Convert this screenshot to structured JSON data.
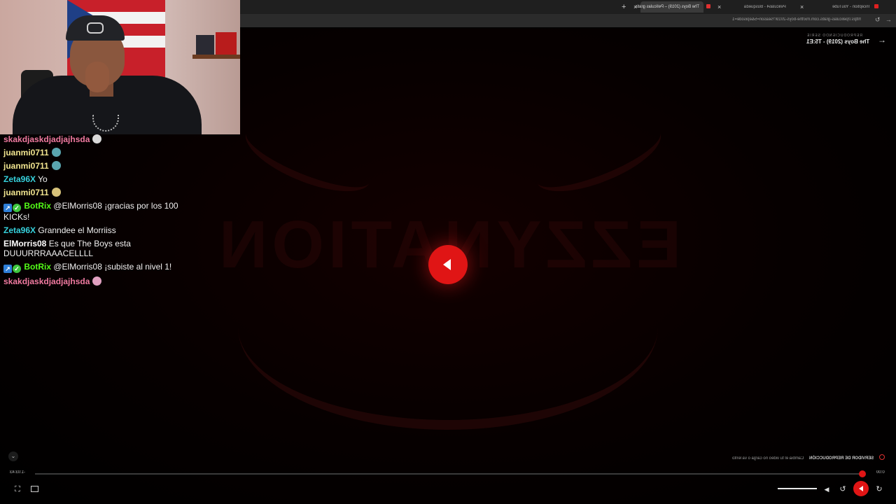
{
  "browser": {
    "tabs": [
      {
        "label": "Inception - YouTube"
      },
      {
        "label": "Peliculas4 - Búsqueda"
      },
      {
        "label": "The Boys (2019) – Películas gratis"
      }
    ],
    "new_tab": "+",
    "url": "https://peliculas-gratis.com.mx/the-boys-2019/?season=5&episode=1",
    "nav": {
      "back": "←",
      "reload": "↻",
      "forward": "→"
    }
  },
  "chat": {
    "messages": [
      {
        "user": "skakdjaskdjadjajhsda",
        "text": "",
        "color": "#f07aa0",
        "emoji": "#d9d9d9",
        "bot": false
      },
      {
        "user": "juanmi0711",
        "text": "",
        "color": "#f2e690",
        "emoji": "#5aa6b0",
        "bot": false
      },
      {
        "user": "juanmi0711",
        "text": "",
        "color": "#f2e690",
        "emoji": "#5aa6b0",
        "bot": false
      },
      {
        "user": "Zeta96X",
        "text": "Yo",
        "color": "#36d1dc",
        "emoji": "",
        "bot": false
      },
      {
        "user": "juanmi0711",
        "text": "",
        "color": "#f2e690",
        "emoji": "#d8c27a",
        "bot": false
      },
      {
        "user": "BotRix",
        "text": "@ElMorris08 ¡gracias por los 100 KICKs!",
        "color": "#53fc18",
        "emoji": "",
        "bot": true
      },
      {
        "user": "Zeta96X",
        "text": "Granndee el Morriiss",
        "color": "#36d1dc",
        "emoji": "",
        "bot": false
      },
      {
        "user": "ElMorris08",
        "text": "Es que The Boys esta DUUURRRAAACELLLL",
        "color": "#ffffff",
        "emoji": "",
        "bot": false
      },
      {
        "user": "BotRix",
        "text": "@ElMorris08 ¡subiste al nivel 1!",
        "color": "#53fc18",
        "emoji": "",
        "bot": true
      },
      {
        "user": "skakdjaskdjadjajhsda",
        "text": "",
        "color": "#f07aa0",
        "emoji": "#e0a0c0",
        "bot": false
      }
    ]
  },
  "player": {
    "now_playing_label": "REPRODUCIENDO SERIE",
    "title": "The Boys (2019) - T5:E1",
    "brand_text": "EZZYNATION",
    "server_label": "SERVIDOR DE REPRODUCCIÓN",
    "server_hint": "Cambia el tu video no carga o va lento",
    "time_elapsed": "0:00",
    "time_remaining": "-1:03:43",
    "progress": 0.0,
    "volume": 1.0,
    "accent_color": "#e01515",
    "icons": [
      "back-arrow-icon",
      "play-icon",
      "fullscreen-icon",
      "pip-icon",
      "rewind-icon",
      "forward-icon",
      "volume-icon",
      "chevron-down-icon"
    ]
  }
}
